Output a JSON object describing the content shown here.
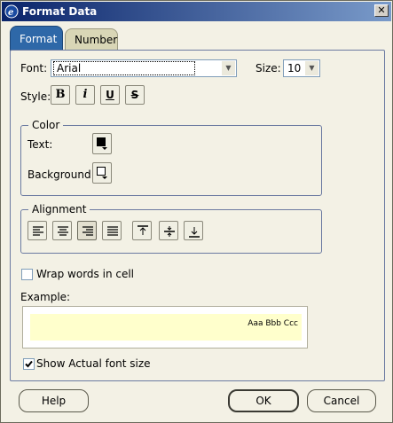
{
  "window": {
    "title": "Format Data",
    "close_glyph": "✕"
  },
  "tabs": [
    {
      "label": "Format",
      "active": true
    },
    {
      "label": "Number",
      "active": false
    }
  ],
  "font": {
    "label": "Font:",
    "value": "Arial",
    "size_label": "Size:",
    "size_value": "10"
  },
  "style": {
    "label": "Style:",
    "buttons": [
      {
        "name": "bold",
        "glyph": "B"
      },
      {
        "name": "italic",
        "glyph": "i"
      },
      {
        "name": "underline",
        "glyph": "U"
      },
      {
        "name": "strikethrough",
        "glyph": "S"
      }
    ]
  },
  "color_group": {
    "title": "Color",
    "text_label": "Text:",
    "background_label": "Background:"
  },
  "alignment_group": {
    "title": "Alignment",
    "buttons": [
      {
        "name": "align-left"
      },
      {
        "name": "align-center"
      },
      {
        "name": "align-right"
      },
      {
        "name": "align-justify"
      },
      {
        "name": "align-top"
      },
      {
        "name": "align-middle"
      },
      {
        "name": "align-bottom"
      }
    ]
  },
  "wrap": {
    "label": "Wrap words in cell",
    "checked": false
  },
  "example": {
    "label": "Example:",
    "sample_text": "Aaa Bbb Ccc"
  },
  "show_actual": {
    "label": "Show Actual font size",
    "checked": true
  },
  "buttons": {
    "help": "Help",
    "ok": "OK",
    "cancel": "Cancel"
  }
}
